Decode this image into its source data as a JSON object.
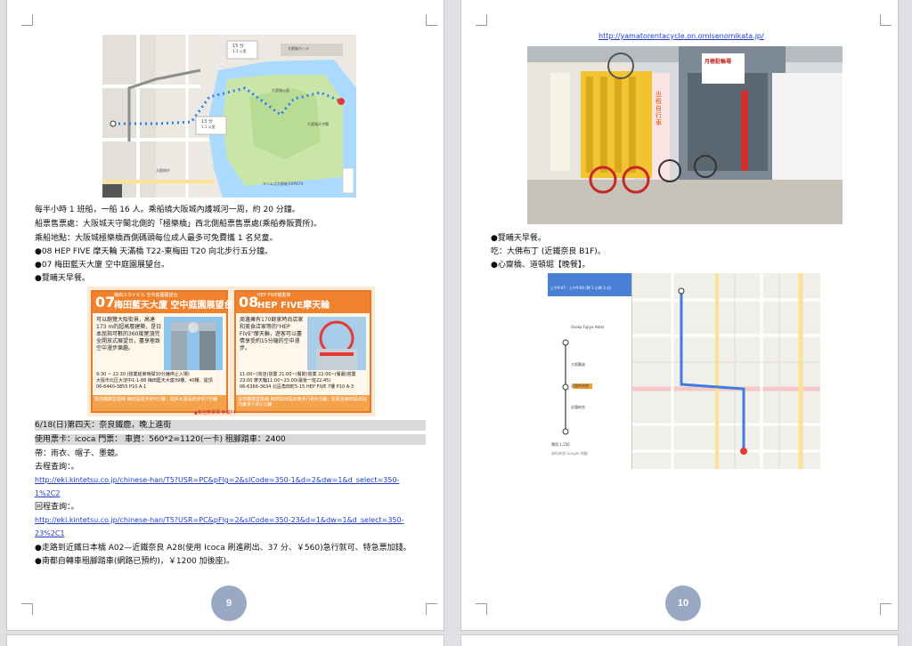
{
  "page9": {
    "page_number": "9",
    "map_labels": {
      "dist1": "15 分",
      "dist1b": "1.2 公里",
      "dist2": "13 分",
      "dist2b": "1.1 公里",
      "place_a": "大阪城ホール",
      "place_b": "大阪城公園",
      "place_c": "大阪城天守閣",
      "place_d": "大阪府庁",
      "place_e": "タイムズ大阪城 EXPO70"
    },
    "lines": [
      "每半小時 1 班船，一船 16 人。乘船繞大阪城內護城河一周，約 20 分鐘。",
      "船票售票處：大阪城天守閣北側的「極樂橋」西北側船票售票處(乘船券販賣所)。",
      "乘船地點：大阪城極樂橋西側碼頭每位成人最多可免費攜 1 名兒童。",
      "●08 HEP FIVE 摩天輪  天滿橋 T22-東梅田 T20 向北步行五分鐘。",
      "●07  梅田藍天大廈  空中庭園展望台。",
      "●覽晡天早餐。"
    ],
    "ad": {
      "left": {
        "num": "07",
        "title": "梅田藍天大廈 空中庭園展望台",
        "subtitle": "梅田スカイビル 空中庭園展望台",
        "body": "可以飽覽大阪街景，高達173 m的超高層建築，是日本屈指可數的360度屋頂完全開放式展望台，盡享極致空中漫步樂趣。",
        "hours": "9:30 ~ 22:30 (營業結束時間30分鐘停止入場)",
        "addr": "大阪市北区大淀中1-1-88 梅田藍天大廈39樓、40樓、屋頂",
        "tel": "06-6440-3855",
        "grid": "P10 A-1"
      },
      "right": {
        "num": "08",
        "title": "HEP FIVE摩天輪",
        "subtitle": "HEP FIVE観覧車",
        "body": "周邊擁有170餘家時尚店家和美食店家等的\"HEP FIVE\"摩天輪，遊客可以盡情享受約15分鐘的空中漫步。",
        "hours": "11:00~(商店)營業 21:00~(餐飲)營業 22:00~(餐廳)營業 23:00 摩天輪11:00~23:00(最後一班22:45)",
        "addr": "北區角田町5-15 HEP FIVE 7樓",
        "tel": "06-6366-3634",
        "grid": "P10 A-3"
      },
      "foot_left": "從地鐵御堂筋線 梅田站徒步約9分鐘；從JR大阪站徒步約7分鐘",
      "foot_right": "從地鐵御堂筋線 梅田站出站向東步行約6分鐘；從阪急梅田站出站向東步行約1分鐘",
      "notice": "▲有注意事項 參閱P4"
    },
    "shaded_lines": [
      "6/18(日)第四天：奈良鐵鹿，晚上進街",
      "使用票卡：icoca     門票：     車資：560*2=1120(一卡)    租腳踏車：2400"
    ],
    "lines2": [
      "帶：雨衣、帽子、墨鏡。",
      "去程查詢：。"
    ],
    "link1a": "http://eki.kintetsu.co.jp/chinese-han/T5?USR=PC&pFlg=2&slCode=350-1&d=2&dw=1&d_select=350-",
    "link1b": "1%2C2",
    "return_label": "回程查詢：。",
    "link2a": "http://eki.kintetsu.co.jp/chinese-han/T5?USR=PC&pFlg=2&slCode=350-23&d=1&dw=1&d_select=350-",
    "link2b": "23%2C1",
    "lines3": [
      "●走路到近鐵日本橋 A02—近鐵奈良 A28(使用 Icoca 刷進刷出、37 分、￥560)急行就可、特急票加錢。",
      "●南都自轉車租腳踏車(網路已預約)，￥1200 加後座)。"
    ]
  },
  "page10": {
    "page_number": "10",
    "url": "http://yamatorentacycle.on.omisenomikata.jp/",
    "sign_text": "月極駐輪場",
    "sign_text2": "出租自行車",
    "lines": [
      "●覽晡天早餐。",
      "吃：大佛布丁 (近鐵奈良 B1F)。",
      "●心齋橋、道頓堀【晚餐】。"
    ],
    "map2": {
      "time_header": "上午9:07 - 上午9:04 (時 1 小時 3 分)",
      "station_top": "Osaka Fujiya Hotel",
      "transfer": "近鐵難波線",
      "stop1": "大阪難波",
      "stop2": "近鐵奈良",
      "route": "近鐵奈良線",
      "footer": "費用 1,250",
      "note": "資料來源 Google 地圖"
    }
  }
}
